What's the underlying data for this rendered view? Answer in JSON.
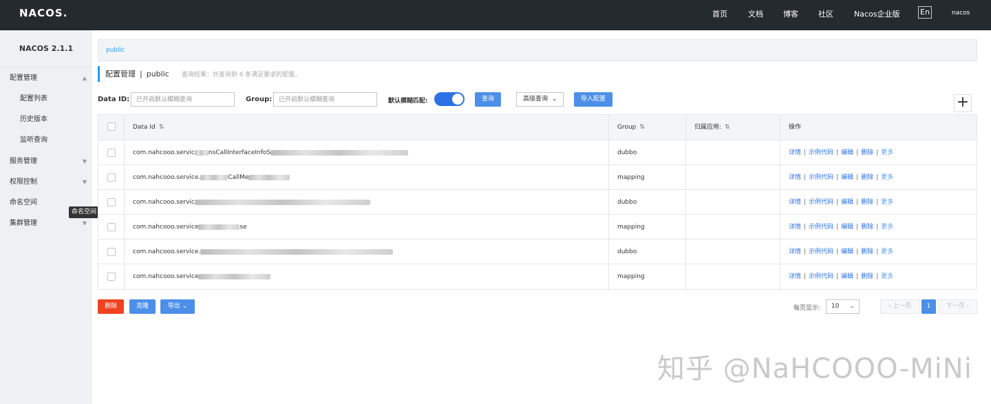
{
  "header": {
    "logo": "NACOS.",
    "nav": [
      "首页",
      "文档",
      "博客",
      "社区",
      "Nacos企业版"
    ],
    "lang": "En",
    "user": "nacos"
  },
  "sidebar": {
    "title": "NACOS 2.1.1",
    "items": [
      {
        "label": "配置管理",
        "expanded": true
      },
      {
        "label": "配置列表",
        "sub": true,
        "active": true
      },
      {
        "label": "历史版本",
        "sub": true
      },
      {
        "label": "监听查询",
        "sub": true
      },
      {
        "label": "服务管理"
      },
      {
        "label": "权限控制"
      },
      {
        "label": "命名空间"
      },
      {
        "label": "集群管理"
      }
    ],
    "tooltip": "命名空间"
  },
  "namespace": {
    "current": "public"
  },
  "page": {
    "title": "配置管理",
    "separator": "|",
    "namespace": "public",
    "result": "查询结果：共查询到 6 条满足要求的配置。"
  },
  "filters": {
    "dataid_label": "Data ID:",
    "dataid_placeholder": "已开启默认模糊查询",
    "group_label": "Group:",
    "group_placeholder": "已开启默认模糊查询",
    "fuzzy_label": "默认模糊匹配:",
    "fuzzy_on": true,
    "search_btn": "查询",
    "advanced_btn": "高级查询",
    "import_btn": "导入配置",
    "add_btn": "+"
  },
  "table": {
    "columns": {
      "dataid": "Data Id",
      "group": "Group",
      "app": "归属应用:",
      "ops": "操作"
    },
    "rows": [
      {
        "data_id": "com.nahcooo.servic",
        "suffix": "nsCallInterfaceInfoS",
        "group": "dubbo",
        "app": ""
      },
      {
        "data_id": "com.nahcooo.service.",
        "suffix": "CallMe",
        "group": "mapping",
        "app": ""
      },
      {
        "data_id": "com.nahcooo.servic",
        "suffix": "",
        "group": "dubbo",
        "app": ""
      },
      {
        "data_id": "com.nahcooo.service",
        "suffix": "se",
        "group": "mapping",
        "app": ""
      },
      {
        "data_id": "com.nahcooo.service.",
        "suffix": "",
        "group": "dubbo",
        "app": ""
      },
      {
        "data_id": "com.nahcooo.service",
        "suffix": "",
        "group": "mapping",
        "app": ""
      }
    ],
    "ops": {
      "detail": "详情",
      "sample": "示例代码",
      "edit": "编辑",
      "delete": "删除",
      "more": "更多",
      "sep": "|"
    }
  },
  "bottom": {
    "delete_btn": "删除",
    "clone_btn": "克隆",
    "export_btn": "导出"
  },
  "pager": {
    "page_size_label": "每页显示:",
    "page_size": "10",
    "prev": "上一页",
    "current": "1",
    "next": "下一页"
  },
  "watermark": "知乎 @NaHCOOO-MiNi",
  "colors": {
    "topbar": "#252a2f",
    "primary": "#4d8fe8",
    "link": "#2c71e6",
    "danger": "#f0421e",
    "sidebar": "#eef0f3"
  }
}
